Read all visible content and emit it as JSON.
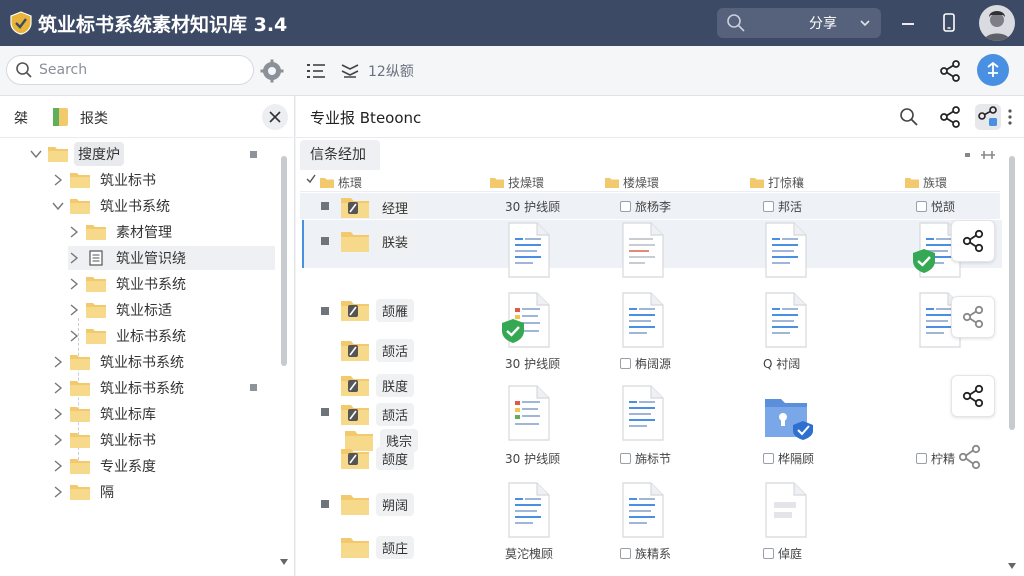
{
  "window": {
    "title": "筑业标书系统素材知识库 3.4",
    "share_label": "分享"
  },
  "toolbar": {
    "search_placeholder": "Search",
    "view_label": "12纵额"
  },
  "sidebar": {
    "header_label1": "桀",
    "header_label2": "报类",
    "tree": [
      {
        "label": "搜度炉",
        "level": 0,
        "expanded": true,
        "highlight": true
      },
      {
        "label": "筑业标书",
        "level": 1
      },
      {
        "label": "筑业书系统",
        "level": 1,
        "expanded": true
      },
      {
        "label": "素材管理",
        "level": 2
      },
      {
        "label": "筑业管识绕",
        "level": 2,
        "selected": true,
        "icon": "doc"
      },
      {
        "label": "筑业书系统",
        "level": 2
      },
      {
        "label": "筑业标适",
        "level": 2
      },
      {
        "label": "业标书系统",
        "level": 2
      },
      {
        "label": "筑业标书系统",
        "level": 1
      },
      {
        "label": "筑业标书系统",
        "level": 1
      },
      {
        "label": "筑业标库",
        "level": 1
      },
      {
        "label": "筑业标书",
        "level": 1
      },
      {
        "label": "专业系度",
        "level": 1
      },
      {
        "label": "隔",
        "level": 1
      }
    ]
  },
  "main": {
    "title": "专业报 Bteoonc",
    "tab_label": "信条经加",
    "columns": [
      "栋環",
      "技燥環",
      "楼燥環",
      "打惊穰",
      "族環"
    ],
    "folder_labels": [
      "经理",
      "朕装",
      "颉雁",
      "颉活",
      "朕度",
      "颉活",
      "贱宗",
      "颉度",
      "朔阔",
      "颉庄"
    ],
    "row1_captions": [
      "30 护线顾",
      "旅杨李",
      "邦活",
      "悦颉"
    ],
    "row3_captions": [
      "30 护线顾",
      "栴阔源",
      "Q 衬阔"
    ],
    "row4_captions": [
      "30 护线顾",
      "旆标节",
      "桦隔顾",
      "柠精"
    ],
    "row5_captions": [
      "莫沱槐顾",
      "族精系",
      "倬庭"
    ]
  },
  "colors": {
    "titlebar": "#3d4a66",
    "accent": "#4a90e2",
    "folder": "#f2c96d",
    "check_green": "#34a853"
  }
}
